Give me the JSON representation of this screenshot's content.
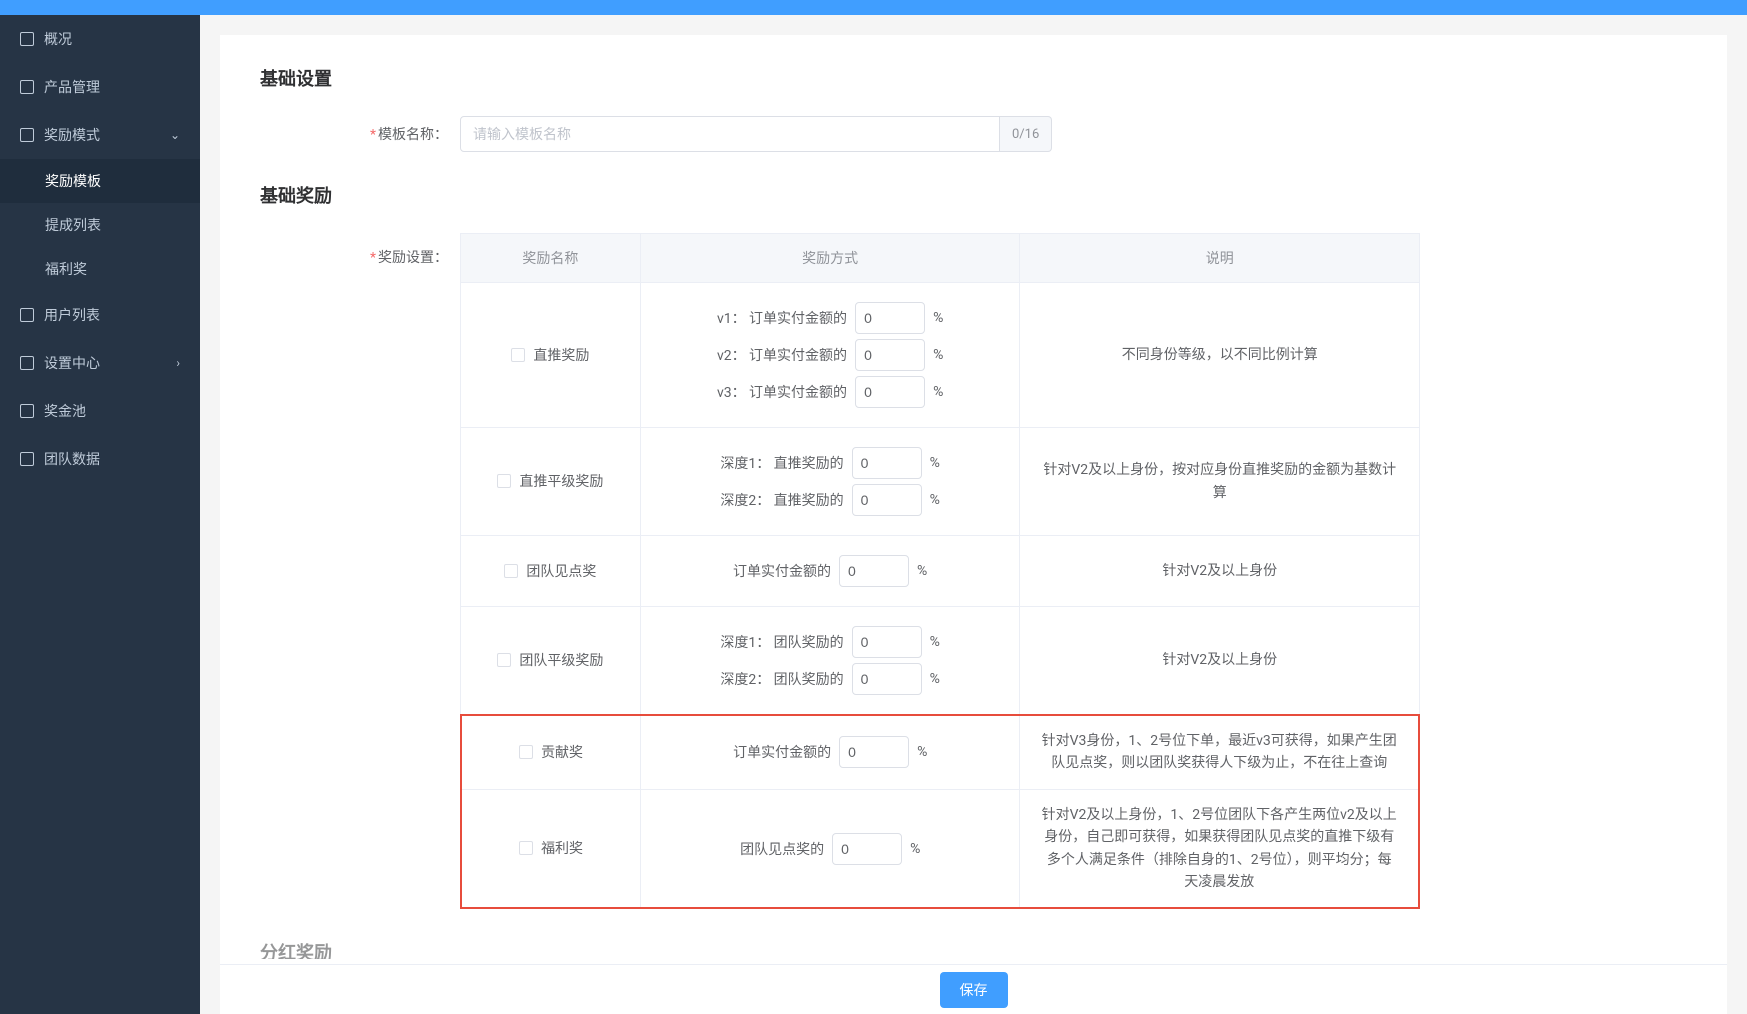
{
  "sidebar": {
    "items": [
      {
        "label": "概况"
      },
      {
        "label": "产品管理"
      },
      {
        "label": "奖励模式",
        "expanded": true,
        "children": [
          {
            "label": "奖励模板",
            "active": true
          },
          {
            "label": "提成列表"
          },
          {
            "label": "福利奖"
          }
        ]
      },
      {
        "label": "用户列表"
      },
      {
        "label": "设置中心",
        "expandable": true
      },
      {
        "label": "奖金池"
      },
      {
        "label": "团队数据"
      }
    ]
  },
  "sections": {
    "basic_settings_title": "基础设置",
    "basic_reward_title": "基础奖励",
    "dividend_title": "分红奖励"
  },
  "form": {
    "template_name_label": "模板名称：",
    "template_name_placeholder": "请输入模板名称",
    "template_name_counter": "0/16",
    "reward_setting_label": "奖励设置："
  },
  "table": {
    "headers": [
      "奖励名称",
      "奖励方式",
      "说明"
    ],
    "rows": [
      {
        "name": "直推奖励",
        "lines": [
          {
            "prefix": "v1： 订单实付金额的",
            "value": "0",
            "suffix": "%"
          },
          {
            "prefix": "v2： 订单实付金额的",
            "value": "0",
            "suffix": "%"
          },
          {
            "prefix": "v3： 订单实付金额的",
            "value": "0",
            "suffix": "%"
          }
        ],
        "desc": "不同身份等级，以不同比例计算"
      },
      {
        "name": "直推平级奖励",
        "lines": [
          {
            "prefix": "深度1： 直推奖励的",
            "value": "0",
            "suffix": "%"
          },
          {
            "prefix": "深度2： 直推奖励的",
            "value": "0",
            "suffix": "%"
          }
        ],
        "desc": "针对V2及以上身份，按对应身份直推奖励的金额为基数计算"
      },
      {
        "name": "团队见点奖",
        "lines": [
          {
            "prefix": "订单实付金额的",
            "value": "0",
            "suffix": "%"
          }
        ],
        "desc": "针对V2及以上身份"
      },
      {
        "name": "团队平级奖励",
        "lines": [
          {
            "prefix": "深度1： 团队奖励的",
            "value": "0",
            "suffix": "%"
          },
          {
            "prefix": "深度2： 团队奖励的",
            "value": "0",
            "suffix": "%"
          }
        ],
        "desc": "针对V2及以上身份"
      }
    ],
    "highlight_rows": [
      {
        "name": "贡献奖",
        "lines": [
          {
            "prefix": "订单实付金额的",
            "value": "0",
            "suffix": "%"
          }
        ],
        "desc": "针对V3身份，1、2号位下单，最近v3可获得，如果产生团队见点奖，则以团队奖获得人下级为止，不在往上查询"
      },
      {
        "name": "福利奖",
        "lines": [
          {
            "prefix": "团队见点奖的",
            "value": "0",
            "suffix": "%"
          }
        ],
        "desc": "针对V2及以上身份，1、2号位团队下各产生两位v2及以上身份，自己即可获得，如果获得团队见点奖的直推下级有多个人满足条件（排除自身的1、2号位），则平均分；每天凌晨发放"
      }
    ]
  },
  "footer": {
    "save_label": "保存"
  }
}
